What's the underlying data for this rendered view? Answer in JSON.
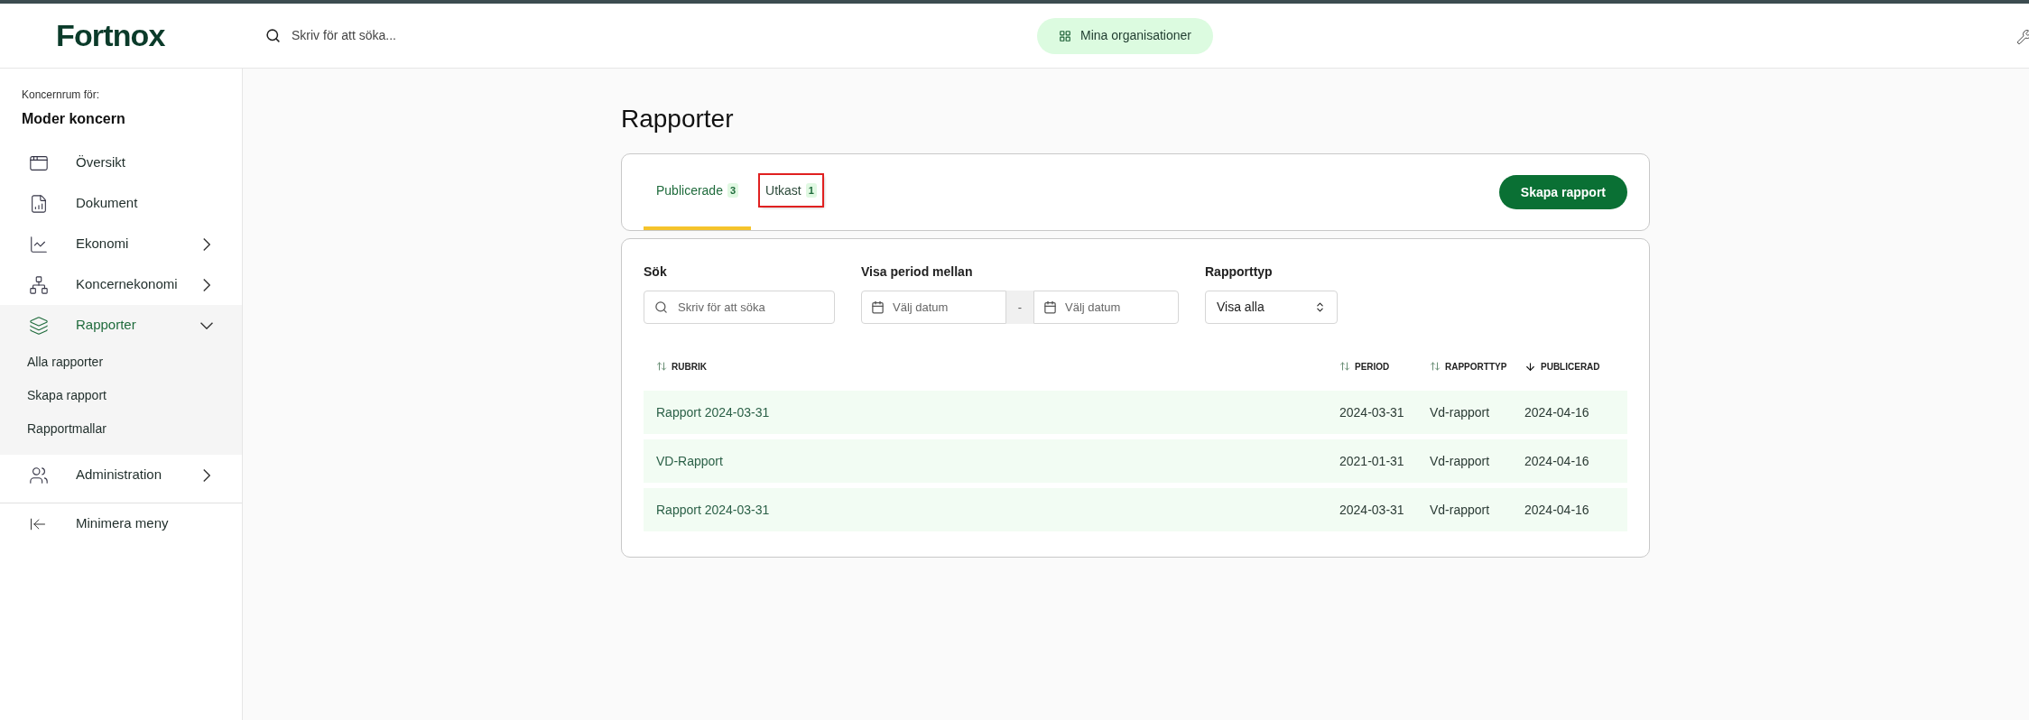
{
  "header": {
    "logo": "Fortnox",
    "search": {
      "placeholder": "Skriv för att söka..."
    },
    "org_button": "Mina organisationer"
  },
  "sidebar": {
    "caption": "Koncernrum för:",
    "company": "Moder koncern",
    "items": [
      {
        "kind": "link",
        "label": "Översikt",
        "selected": false
      },
      {
        "kind": "link",
        "label": "Dokument",
        "selected": false
      },
      {
        "kind": "group",
        "label": "Ekonomi",
        "selected": false,
        "expanded": false
      },
      {
        "kind": "group",
        "label": "Koncernekonomi",
        "selected": false,
        "expanded": false
      },
      {
        "kind": "group",
        "label": "Rapporter",
        "selected": true,
        "expanded": true,
        "children": [
          {
            "label": "Alla rapporter"
          },
          {
            "label": "Skapa rapport"
          },
          {
            "label": "Rapportmallar"
          }
        ]
      },
      {
        "kind": "group",
        "label": "Administration",
        "selected": false,
        "expanded": false
      }
    ],
    "collapse": "Minimera meny"
  },
  "page": {
    "title": "Rapporter",
    "tabs": [
      {
        "label": "Publicerade",
        "count": "3",
        "selected": true,
        "highlighted": false
      },
      {
        "label": "Utkast",
        "count": "1",
        "selected": false,
        "highlighted": true
      }
    ],
    "create_button": "Skapa rapport",
    "filters": {
      "search": {
        "label": "Sök",
        "placeholder": "Skriv för att söka"
      },
      "period": {
        "label": "Visa period mellan",
        "from_placeholder": "Välj datum",
        "separator": "-",
        "to_placeholder": "Välj datum"
      },
      "type": {
        "label": "Rapporttyp",
        "value": "Visa alla"
      }
    },
    "table": {
      "columns": [
        {
          "label": "RUBRIK",
          "selected": false
        },
        {
          "label": "PERIOD",
          "selected": false
        },
        {
          "label": "RAPPORTTYP",
          "selected": false
        },
        {
          "label": "PUBLICERAD",
          "selected": true
        }
      ],
      "rows": [
        [
          "Rapport 2024-03-31",
          "2024-03-31",
          "Vd-rapport",
          "2024-04-16"
        ],
        [
          "VD-Rapport",
          "2021-01-31",
          "Vd-rapport",
          "2024-04-16"
        ],
        [
          "Rapport 2024-03-31",
          "2024-03-31",
          "Vd-rapport",
          "2024-04-16"
        ]
      ]
    }
  }
}
